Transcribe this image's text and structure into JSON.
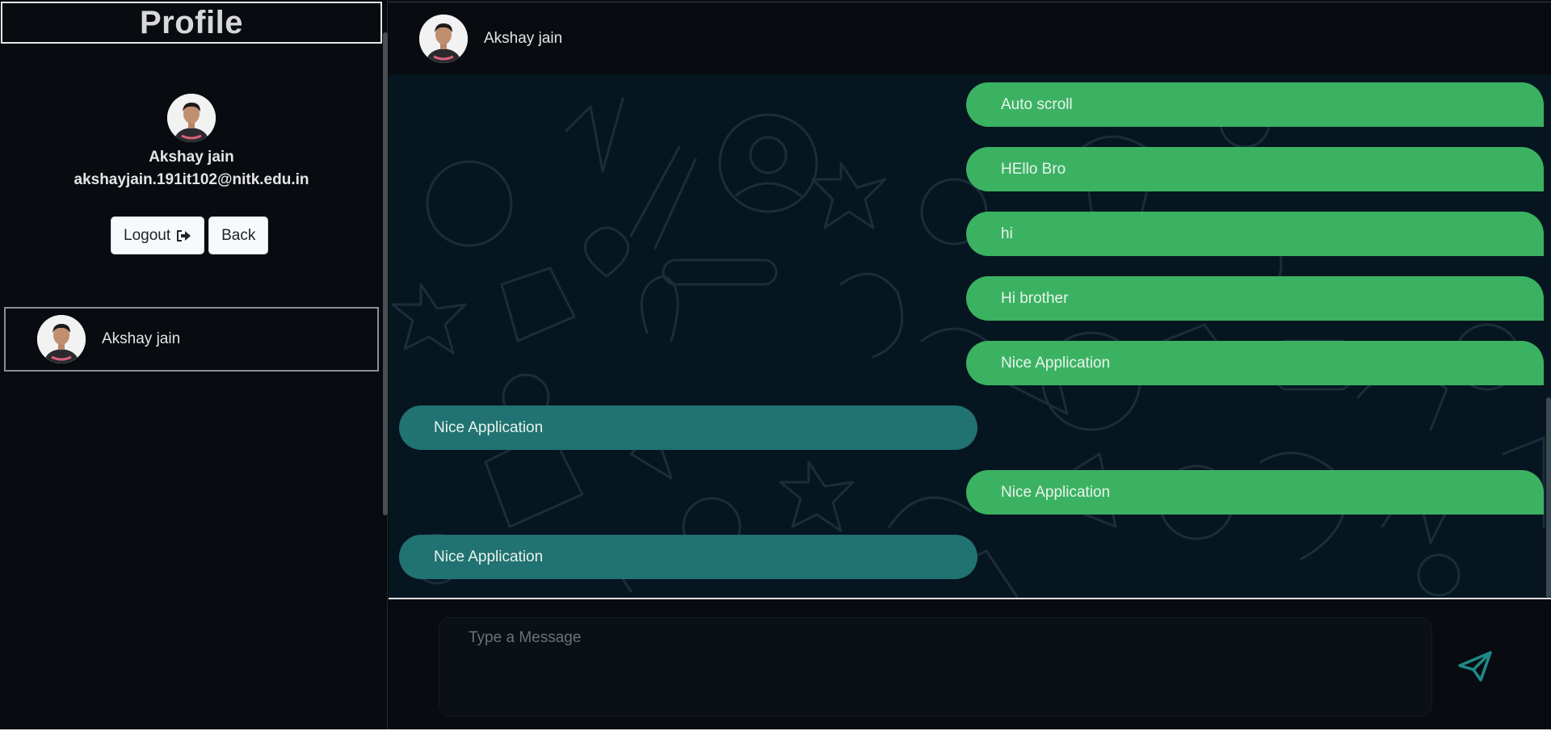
{
  "sidebar": {
    "title": "Profile",
    "profile": {
      "name": "Akshay jain",
      "email": "akshayjain.191it102@nitk.edu.in"
    },
    "buttons": {
      "logout_label": "Logout",
      "back_label": "Back"
    },
    "contacts": [
      {
        "name": "Akshay jain"
      }
    ]
  },
  "chat": {
    "header_name": "Akshay jain",
    "messages": [
      {
        "text": "Auto scroll",
        "direction": "sent"
      },
      {
        "text": "HEllo Bro",
        "direction": "sent"
      },
      {
        "text": "hi",
        "direction": "sent"
      },
      {
        "text": "Hi brother",
        "direction": "sent"
      },
      {
        "text": "Nice Application",
        "direction": "sent"
      },
      {
        "text": "Nice Application",
        "direction": "received"
      },
      {
        "text": "Nice Application",
        "direction": "sent"
      },
      {
        "text": "Nice Application",
        "direction": "received"
      }
    ],
    "input": {
      "placeholder": "Type a Message",
      "value": ""
    }
  },
  "icons": {
    "logout": "sign-out-icon",
    "send": "paper-plane-icon"
  },
  "colors": {
    "background": "#080c10",
    "chat_background": "#061620",
    "sent_bubble": "#3bb262",
    "received_bubble": "#217272",
    "send_icon": "#1f8a8a"
  }
}
